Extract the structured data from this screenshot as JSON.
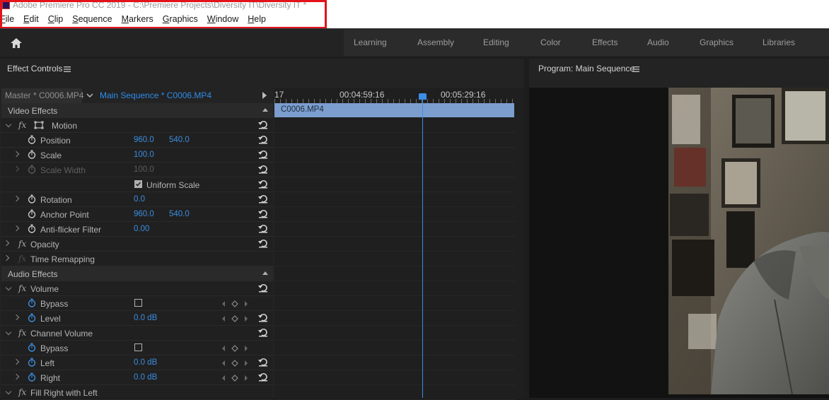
{
  "window": {
    "title": "Adobe Premiere Pro CC 2019 - C:\\Premiere Projects\\Diversity IT\\Diversity IT *"
  },
  "menu": [
    {
      "u": "F",
      "rest": "ile"
    },
    {
      "u": "E",
      "rest": "dit"
    },
    {
      "u": "C",
      "rest": "lip"
    },
    {
      "u": "S",
      "rest": "equence"
    },
    {
      "u": "M",
      "rest": "arkers"
    },
    {
      "u": "G",
      "rest": "raphics"
    },
    {
      "u": "W",
      "rest": "indow"
    },
    {
      "u": "H",
      "rest": "elp"
    }
  ],
  "workspaces": [
    "Learning",
    "Assembly",
    "Editing",
    "Color",
    "Effects",
    "Audio",
    "Graphics",
    "Libraries"
  ],
  "effect_controls": {
    "title": "Effect Controls",
    "master_label": "Master * C0006.MP4",
    "sequence_label": "Main Sequence * C0006.MP4",
    "video_effects": "Video Effects",
    "motion": "Motion",
    "position": {
      "label": "Position",
      "x": "960.0",
      "y": "540.0"
    },
    "scale": {
      "label": "Scale",
      "value": "100.0"
    },
    "scale_width": {
      "label": "Scale Width",
      "value": "100.0"
    },
    "uniform_scale": {
      "label": "Uniform Scale",
      "checked": true
    },
    "rotation": {
      "label": "Rotation",
      "value": "0.0"
    },
    "anchor_point": {
      "label": "Anchor Point",
      "x": "960.0",
      "y": "540.0"
    },
    "anti_flicker": {
      "label": "Anti-flicker Filter",
      "value": "0.00"
    },
    "opacity": "Opacity",
    "time_remapping": "Time Remapping",
    "audio_effects": "Audio Effects",
    "volume": "Volume",
    "bypass": "Bypass",
    "level": {
      "label": "Level",
      "value": "0.0 dB"
    },
    "channel_volume": "Channel Volume",
    "left": {
      "label": "Left",
      "value": "0.0 dB"
    },
    "right": {
      "label": "Right",
      "value": "0.0 dB"
    },
    "fill_right": "Fill Right with Left"
  },
  "timeline": {
    "tc_partial": "17",
    "tc_1": "00:04:59:16",
    "tc_2": "00:05:29:16",
    "clip_name": "C0006.MP4"
  },
  "program_monitor": {
    "title": "Program: Main Sequence"
  },
  "colors": {
    "accent_blue": "#2d8ceb",
    "highlight_red": "#e3131b",
    "clip_blue": "#7b9ecf"
  }
}
